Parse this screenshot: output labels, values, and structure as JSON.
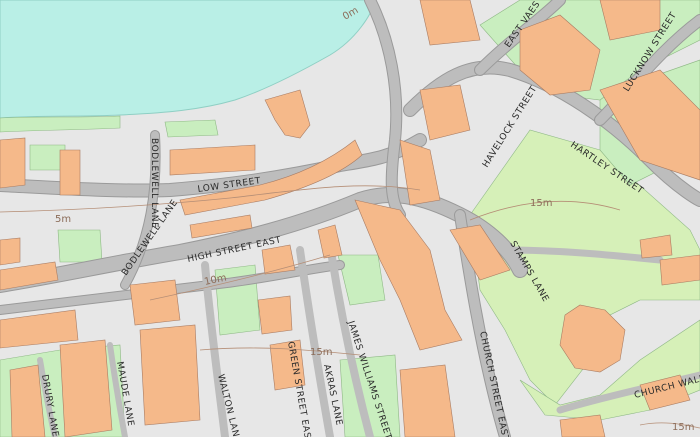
{
  "colors": {
    "water": "#b9efe6",
    "building": "#f5b98a",
    "green": "#c9eebf",
    "park": "#d6f0b8",
    "road": "#bdbdbd",
    "land": "#e7e7e7",
    "contour": "#b58e76"
  },
  "streets": {
    "east_vaes": "EAST VAES",
    "lucknow_street": "LUCKNOW STREET",
    "havelock_street": "HAVELOCK STREET",
    "hartley_street": "HARTLEY STREET",
    "bodlewell_lane_upper": "BODLEWELL LANE",
    "bodlewell_lane_lower": "BODLEWELL LANE",
    "low_street": "LOW STREET",
    "high_street_east": "HIGH STREET EAST",
    "stamps_lane": "STAMPS LANE",
    "church_street_east": "CHURCH STREET EAST",
    "church_walk": "CHURCH WALK",
    "james_williams_street": "JAMES WILLIAMS STREET",
    "green_street_east": "GREEN STREET EAST",
    "akras_lane": "AKRAS LANE",
    "walton_lane": "WALTON LANE",
    "maude_lane": "MAUDE LANE",
    "drury_lane": "DRURY LANE"
  },
  "contours": {
    "c0": "0m",
    "c5": "5m",
    "c10": "10m",
    "c15a": "15m",
    "c15b": "15m",
    "c15c": "15m"
  }
}
